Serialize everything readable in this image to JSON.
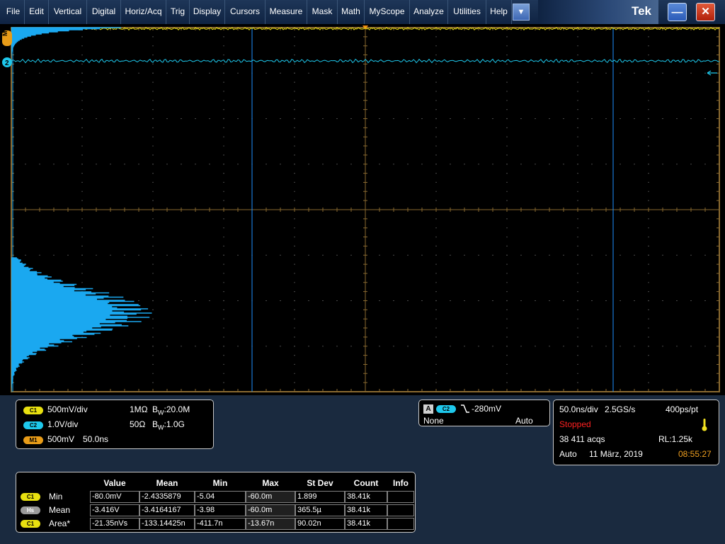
{
  "menu": [
    "File",
    "Edit",
    "Vertical",
    "Digital",
    "Horiz/Acq",
    "Trig",
    "Display",
    "Cursors",
    "Measure",
    "Mask",
    "Math",
    "MyScope",
    "Analyze",
    "Utilities",
    "Help"
  ],
  "menu_dropdown_icon": "chevron-down-icon",
  "brand": "Tek",
  "window_buttons": {
    "minimize_icon": "minimize-icon",
    "close_icon": "close-icon",
    "minimize_glyph": "—",
    "close_glyph": "✕"
  },
  "scope": {
    "markers": {
      "m1": "M1",
      "ch2": "2"
    },
    "colors": {
      "grid": "#8a6a30",
      "ch1": "#e8e010",
      "ch2": "#1ec8ec",
      "cursor": "#1e90ff",
      "histogram": "#1aa8f0"
    }
  },
  "channels": {
    "c1": {
      "badge": "C1",
      "scale": "500mV/div",
      "impedance": "1MΩ",
      "bw_prefix": "B",
      "bw_sub": "W",
      "bandwidth": ":20.0M"
    },
    "c2": {
      "badge": "C2",
      "scale": "1.0V/div",
      "impedance": "50Ω",
      "bw_prefix": "B",
      "bw_sub": "W",
      "bandwidth": ":1.0G"
    },
    "m1": {
      "badge": "M1",
      "scale": "500mV",
      "time": "50.0ns"
    }
  },
  "trigger": {
    "label": "A",
    "source": "C2",
    "slope_icon": "falling-edge-icon",
    "level": "-280mV",
    "coupling": "None",
    "mode": "Auto"
  },
  "acquisition": {
    "timebase": "50.0ns/div",
    "sample_rate": "2.5GS/s",
    "resolution": "400ps/pt",
    "state": "Stopped",
    "state_color": "#ff2020",
    "acqs": "38 411 acqs",
    "record_length": "RL:1.25k",
    "mode": "Auto",
    "date": "11 März, 2019",
    "time": "08:55:27",
    "time_color": "#f0a020",
    "thermometer_icon": "thermometer-icon"
  },
  "measurements": {
    "headers": [
      "Value",
      "Mean",
      "Min",
      "Max",
      "St Dev",
      "Count",
      "Info"
    ],
    "rows": [
      {
        "badge": "C1",
        "badge_type": "c1",
        "label": "Min",
        "cells": [
          "-80.0mV",
          "-2.4335879",
          "-5.04",
          "-60.0m",
          "1.899",
          "38.41k",
          ""
        ]
      },
      {
        "badge": "Hs",
        "badge_type": "hs",
        "label": "Mean",
        "cells": [
          "-3.416V",
          "-3.4164167",
          "-3.98",
          "-60.0m",
          "365.5µ",
          "38.41k",
          ""
        ]
      },
      {
        "badge": "C1",
        "badge_type": "c1",
        "label": "Area*",
        "cells": [
          "-21.35nVs",
          "-133.14425n",
          "-411.7n",
          "-13.67n",
          "90.02n",
          "38.41k",
          ""
        ]
      }
    ]
  }
}
